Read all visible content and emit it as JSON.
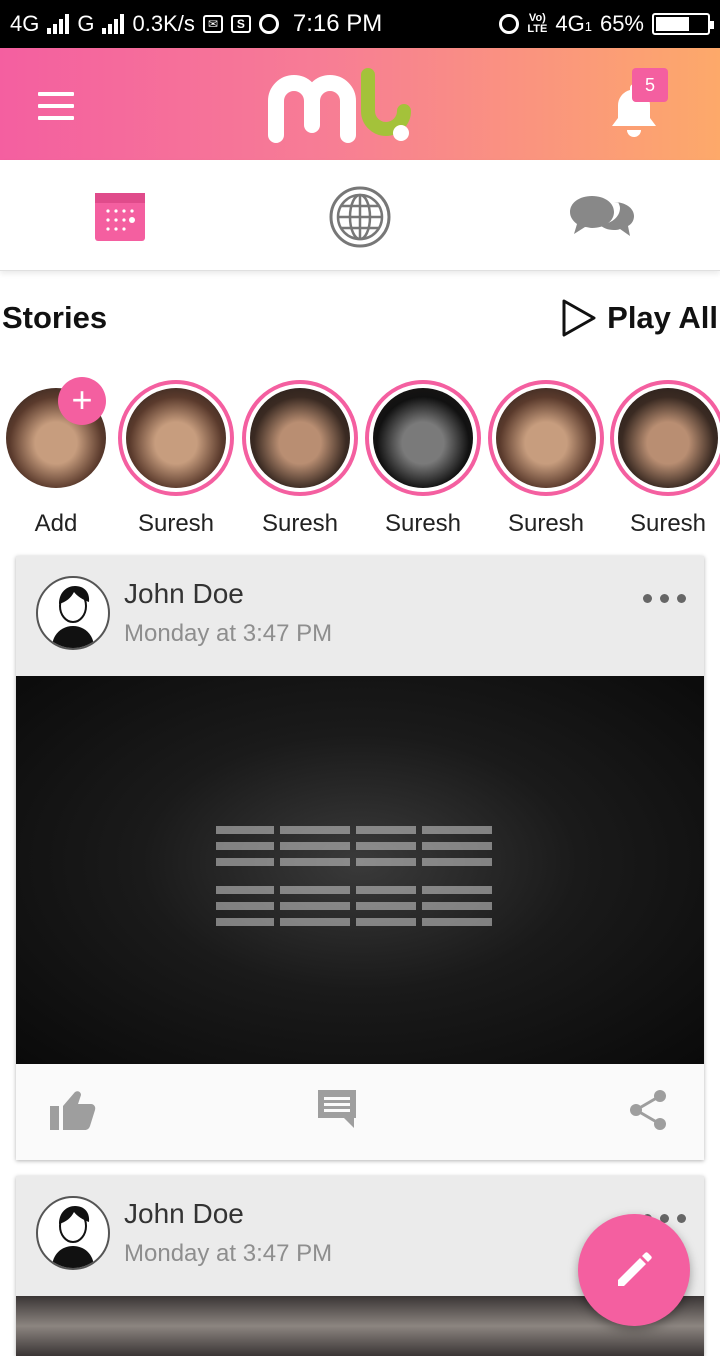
{
  "status_bar": {
    "network1": "4G",
    "network2": "G",
    "speed": "0.3K/s",
    "icon_s": "S",
    "time": "7:16 PM",
    "lte_top": "Vo)",
    "lte_bottom": "LTE",
    "network3": "4G",
    "network3_sub": "1",
    "battery": "65%",
    "battery_level": 0.65
  },
  "app_bar": {
    "notification_count": "5",
    "logo": "mb"
  },
  "tabs": [
    {
      "name": "calendar-icon"
    },
    {
      "name": "globe-icon"
    },
    {
      "name": "chat-icon"
    }
  ],
  "stories": {
    "title": "Stories",
    "play_all": "Play All",
    "items": [
      {
        "label": "Add"
      },
      {
        "label": "Suresh"
      },
      {
        "label": "Suresh"
      },
      {
        "label": "Suresh"
      },
      {
        "label": "Suresh"
      },
      {
        "label": "Suresh"
      }
    ]
  },
  "posts": [
    {
      "author": "John Doe",
      "time": "Monday at 3:47 PM"
    },
    {
      "author": "John Doe",
      "time": "Monday at 3:47 PM"
    }
  ],
  "colors": {
    "accent": "#f45fa0",
    "gradient_end": "#fda96a",
    "logo_green": "#a4c23a"
  }
}
